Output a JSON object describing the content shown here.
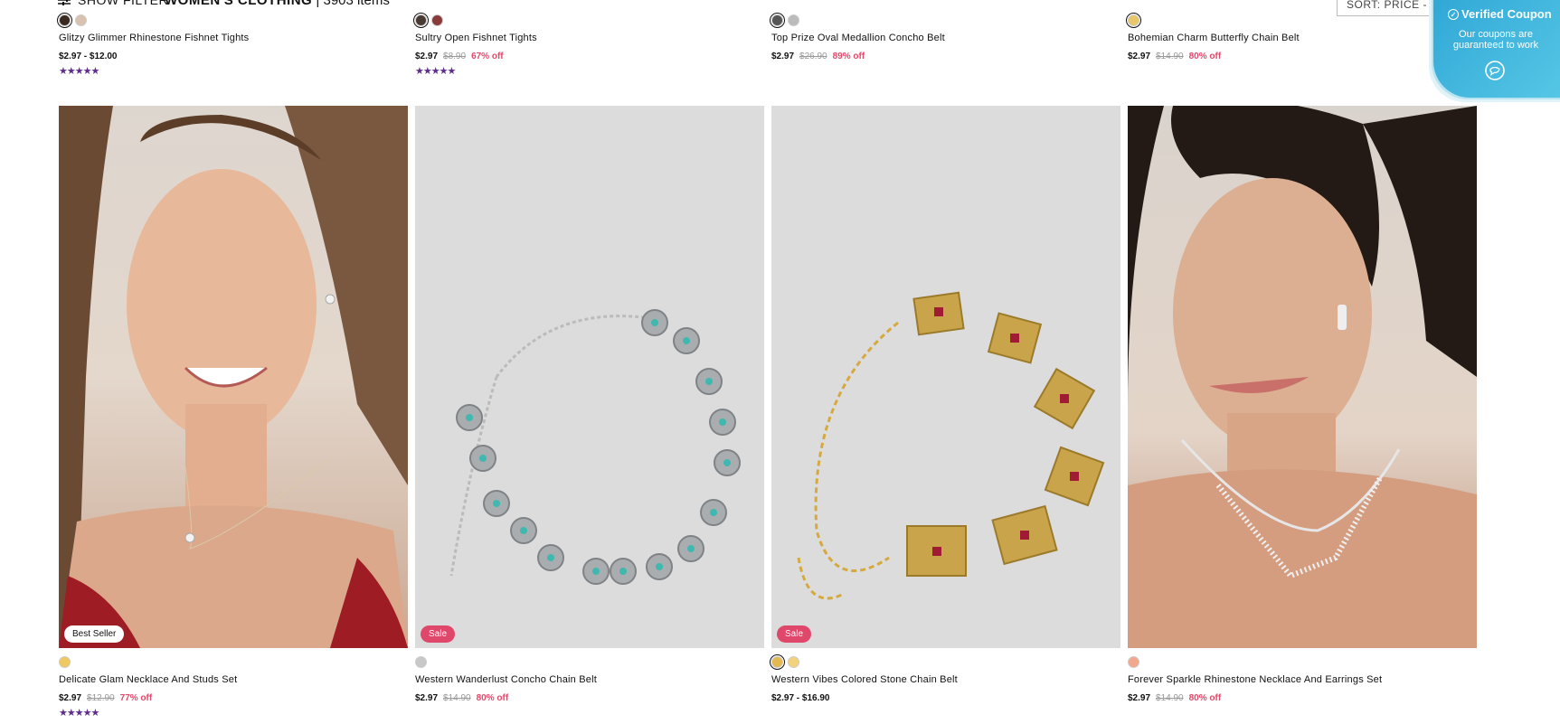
{
  "toolbar": {
    "filter_label": "SHOW FILTER",
    "category": "WOMEN'S CLOTHING",
    "count": "3903 items",
    "separator": "|",
    "sort_label": "SORT: PRICE - LOW ..."
  },
  "coupon": {
    "title": "Verified Coupon",
    "subtitle": "Our coupons are guaranteed to work"
  },
  "top_row": [
    {
      "name": "Glitzy Glimmer Rhinestone Fishnet Tights",
      "price": "$2.97 - $12.00",
      "orig": "",
      "off": "",
      "stars": "★★★★★",
      "swatches": [
        "#3a2a22",
        "#d9c3b0"
      ]
    },
    {
      "name": "Sultry Open Fishnet Tights",
      "price": "$2.97",
      "orig": "$8.90",
      "off": "67% off",
      "stars": "★★★★★",
      "swatches": [
        "#4a3a34",
        "#8a3a3a"
      ]
    },
    {
      "name": "Top Prize Oval Medallion Concho Belt",
      "price": "$2.97",
      "orig": "$26.90",
      "off": "89% off",
      "stars": "",
      "swatches": [
        "#555555",
        "#bbbbbb"
      ]
    },
    {
      "name": "Bohemian Charm Butterfly Chain Belt",
      "price": "$2.97",
      "orig": "$14.90",
      "off": "80% off",
      "stars": "",
      "swatches": [
        "#e8c66a"
      ]
    }
  ],
  "bottom_row": [
    {
      "name": "Delicate Glam Necklace And Studs Set",
      "price": "$2.97",
      "orig": "$12.90",
      "off": "77% off",
      "stars": "★★★★★",
      "badge": "Best Seller",
      "swatches": [
        "#f0c860"
      ]
    },
    {
      "name": "Western Wanderlust Concho Chain Belt",
      "price": "$2.97",
      "orig": "$14.90",
      "off": "80% off",
      "stars": "",
      "badge": "Sale",
      "swatches": [
        "#c8c8c8"
      ]
    },
    {
      "name": "Western Vibes Colored Stone Chain Belt",
      "price": "$2.97 - $16.90",
      "orig": "",
      "off": "",
      "stars": "",
      "badge": "Sale",
      "swatches": [
        "#e5b94d",
        "#f2d27a"
      ]
    },
    {
      "name": "Forever Sparkle Rhinestone Necklace And Earrings Set",
      "price": "$2.97",
      "orig": "$14.90",
      "off": "80% off",
      "stars": "",
      "badge": "",
      "swatches": [
        "#f2a88e"
      ]
    }
  ]
}
